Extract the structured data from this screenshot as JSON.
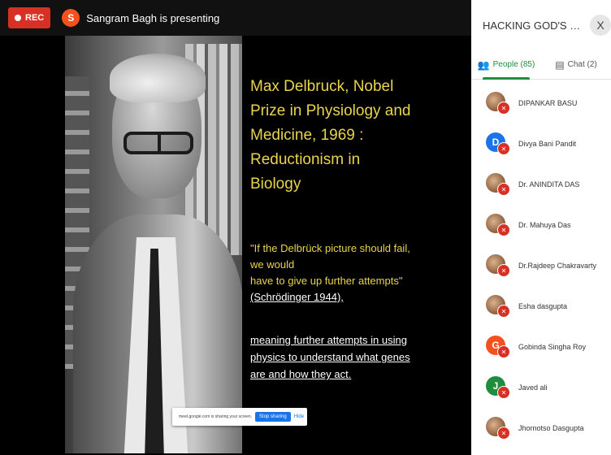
{
  "topbar": {
    "rec_label": "REC",
    "presenter_initial": "S",
    "presenter_text": "Sangram Bagh is presenting"
  },
  "slide": {
    "title": "Max Delbruck, Nobel Prize in Physiology and Medicine, 1969 : Reductionism in Biology",
    "quote_line1": "\"If the Delbrück picture should fail, we would",
    "quote_line2": "have to give up further attempts\"",
    "quote_cite": "(Schrödinger 1944),",
    "meaning": "meaning further attempts in using physics to understand what genes are and how they act.",
    "share_text": "meet.google.com is sharing your screen.",
    "stop_label": "Stop sharing",
    "hide_label": "Hide"
  },
  "panel": {
    "title": "HACKING GOD'S OWN PRO...",
    "close_label": "X",
    "tabs": [
      {
        "label": "People (85)",
        "icon": "people-icon"
      },
      {
        "label": "Chat (2)",
        "icon": "chat-icon"
      }
    ],
    "people": [
      {
        "name": "DIPANKAR BASU",
        "initial": "",
        "avatar_type": "photo",
        "color": "#8a5a3b"
      },
      {
        "name": "Divya Bani Pandit",
        "initial": "D",
        "avatar_type": "letter",
        "color": "#1a73e8"
      },
      {
        "name": "Dr. ANINDITA DAS",
        "initial": "",
        "avatar_type": "photo",
        "color": "#8a5a3b"
      },
      {
        "name": "Dr. Mahuya Das",
        "initial": "",
        "avatar_type": "photo",
        "color": "#8a5a3b"
      },
      {
        "name": "Dr.Rajdeep Chakravarty",
        "initial": "",
        "avatar_type": "photo",
        "color": "#8a5a3b"
      },
      {
        "name": "Esha dasgupta",
        "initial": "",
        "avatar_type": "photo",
        "color": "#8a5a3b"
      },
      {
        "name": "Gobinda Singha Roy",
        "initial": "G",
        "avatar_type": "letter",
        "color": "#f4511e"
      },
      {
        "name": "Javed ali",
        "initial": "J",
        "avatar_type": "letter",
        "color": "#1e8e3e"
      },
      {
        "name": "Jhornotso Dasgupta",
        "initial": "",
        "avatar_type": "photo",
        "color": "#8a5a3b"
      }
    ]
  },
  "colors": {
    "rec": "#d93025",
    "accent_green": "#1e8e3e",
    "slide_text": "#e8d44d"
  }
}
